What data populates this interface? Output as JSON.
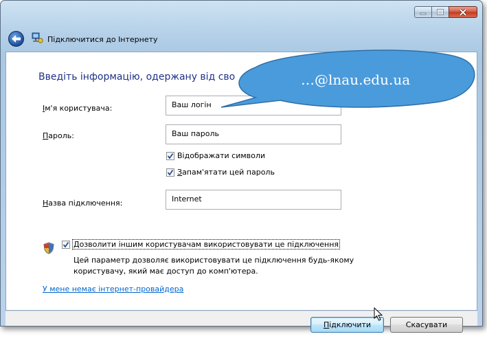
{
  "window": {
    "title": "Підключитися до Інтернету"
  },
  "form": {
    "heading": "Введіть інформацію, одержану від сво",
    "username": {
      "label_accel": "І",
      "label_rest": "м'я користувача:",
      "value": "Ваш логін"
    },
    "password": {
      "label_accel": "П",
      "label_rest": "ароль:",
      "value": "Ваш пароль"
    },
    "show_chars": {
      "pre": "Ві",
      "accel": "д",
      "post": "ображати символи",
      "checked": true
    },
    "remember": {
      "pre": "",
      "accel": "З",
      "post": "апам'ятати цей пароль",
      "checked": true
    },
    "conn_name": {
      "label_accel": "Н",
      "label_rest": "азва підключення:",
      "value": "Internet"
    },
    "allow_others": {
      "accel": "Д",
      "post": "озволити іншим користувачам використовувати це підключення",
      "checked": true
    },
    "allow_desc_1": "Цей параметр дозволяє використовувати це підключення будь-якому",
    "allow_desc_2": "користувачу, який має доступ до комп'ютера.",
    "no_isp_link": "У мене немає інтернет-провайдера"
  },
  "buttons": {
    "connect": {
      "accel": "П",
      "rest": "ідключити"
    },
    "cancel": "Скасувати"
  },
  "callout": {
    "text": "…@lnau.edu.ua",
    "color": "#4a9bdc"
  }
}
